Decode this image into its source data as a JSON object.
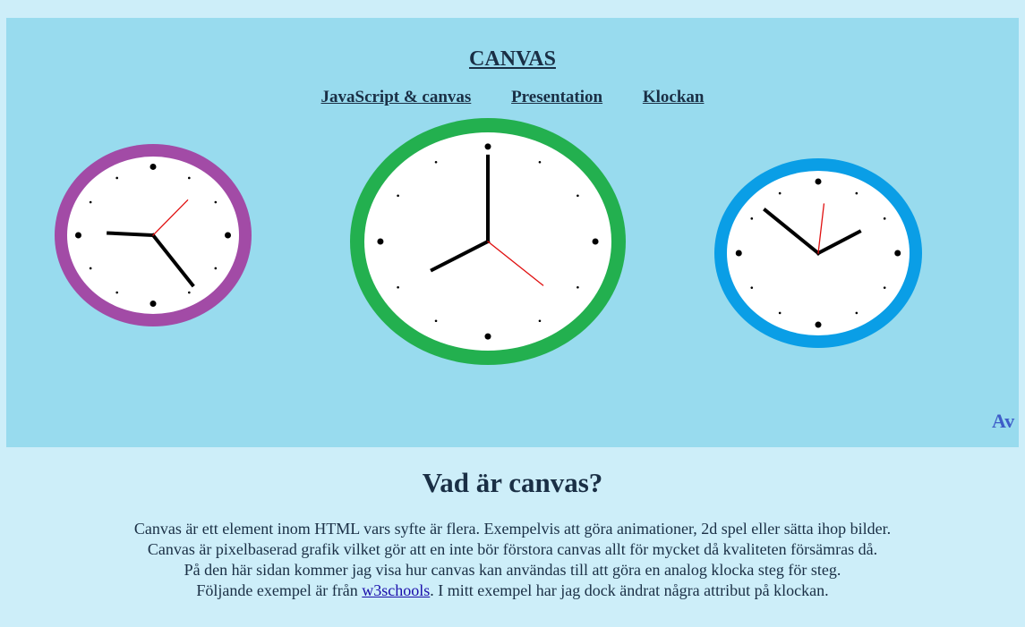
{
  "header": {
    "title": "CANVAS",
    "nav": [
      {
        "label": "JavaScript & canvas"
      },
      {
        "label": "Presentation"
      },
      {
        "label": "Klockan"
      }
    ],
    "marquee_text": "Av"
  },
  "clocks": [
    {
      "name": "purple",
      "ring_color": "#a24ba6",
      "hour": 9.1,
      "minute": 24,
      "second": 7
    },
    {
      "name": "green",
      "ring_color": "#23b04f",
      "hour": 8.0,
      "minute": 0,
      "second": 22
    },
    {
      "name": "blue",
      "ring_color": "#0a9ee6",
      "hour": 2.0,
      "minute": 52,
      "second": 1
    }
  ],
  "content": {
    "heading": "Vad är canvas?",
    "lines": [
      "Canvas är ett element inom HTML vars syfte är flera. Exempelvis att göra animationer, 2d spel eller sätta ihop bilder.",
      "Canvas är pixelbaserad grafik vilket gör att en inte bör förstora canvas allt för mycket då kvaliteten försämras då.",
      "På den här sidan kommer jag visa hur canvas kan användas till att göra en analog klocka steg för steg."
    ],
    "last_line_prefix": "Följande exempel är från ",
    "link_text": "w3schools",
    "last_line_suffix": ". I mitt exempel har jag dock ändrat några attribut på klockan."
  }
}
